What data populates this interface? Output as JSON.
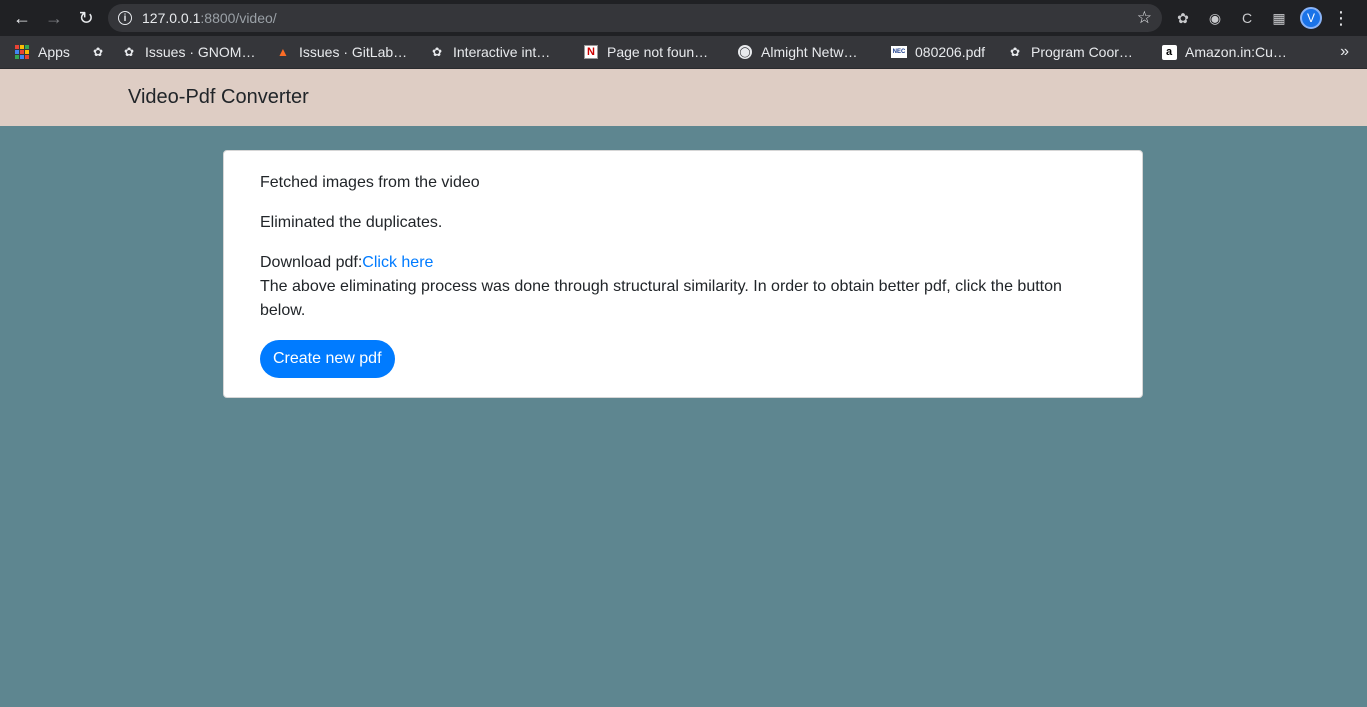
{
  "browser": {
    "url_host": "127.0.0.1",
    "url_rest": ":8800/video/",
    "avatar_letter": "V",
    "icons": [
      "back-icon",
      "forward-icon",
      "reload-icon",
      "info-icon",
      "star-icon",
      "extension-icon",
      "puzzle-icon",
      "menu-icon"
    ]
  },
  "bookmarks": [
    {
      "label": "Apps",
      "icon": "apps-icon"
    },
    {
      "label": "",
      "icon": "gnome-icon"
    },
    {
      "label": "Issues · GNOM…",
      "icon": "gnome-icon"
    },
    {
      "label": "Issues · GitLab…",
      "icon": "gitlab-icon"
    },
    {
      "label": "Interactive int…",
      "icon": "gnome-icon"
    },
    {
      "label": "Page not foun…",
      "icon": "netflix-icon"
    },
    {
      "label": "Almight Netw…",
      "icon": "globe-icon"
    },
    {
      "label": "080206.pdf",
      "icon": "nec-icon"
    },
    {
      "label": "Program Coor…",
      "icon": "gnome-icon"
    },
    {
      "label": "Amazon.in:Cu…",
      "icon": "amazon-icon"
    }
  ],
  "navbar": {
    "brand": "Video-Pdf Converter"
  },
  "card": {
    "line1": "Fetched images from the video",
    "line2": "Eliminated the duplicates.",
    "download_label": "Download pdf:",
    "download_link": "Click here",
    "description": "The above eliminating process was done through structural similarity. In order to obtain better pdf, click the button below.",
    "button_label": "Create new pdf"
  },
  "colors": {
    "background": "#5e8690",
    "navbar": "#decdc4",
    "primary": "#007bff"
  }
}
